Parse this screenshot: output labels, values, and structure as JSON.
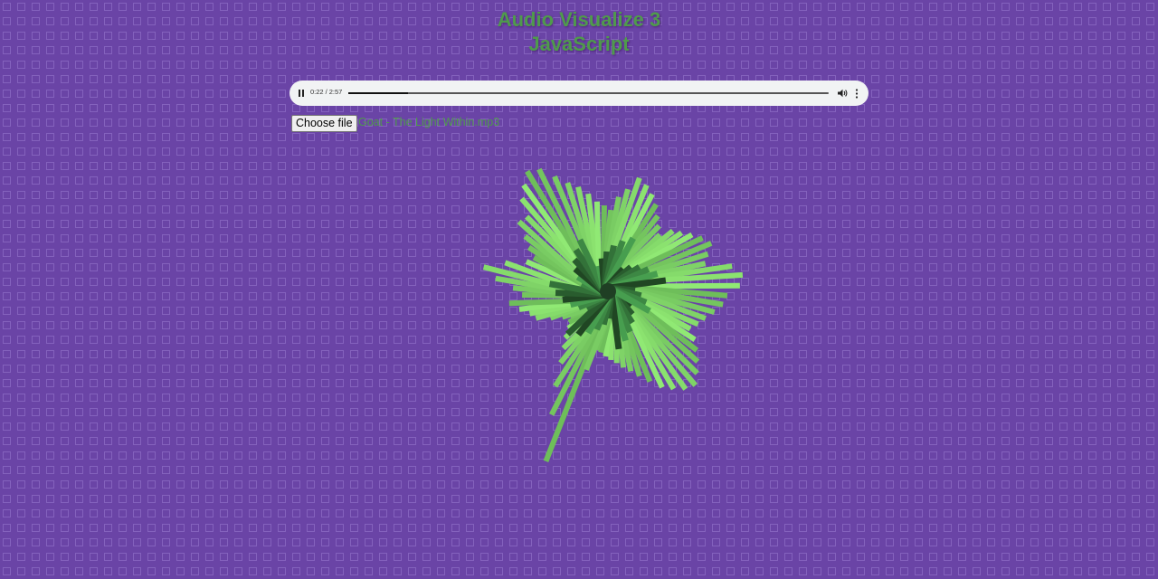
{
  "page": {
    "title_line1": "Audio Visualize 3",
    "title_line2": "JavaScript",
    "background": "#6a44a6",
    "accent": "#4f9a4c"
  },
  "player": {
    "current_time": "0:22",
    "duration": "2:57",
    "separator": "/",
    "progress_fraction": 0.124,
    "play_icon": "pause-icon",
    "volume_icon": "volume-icon",
    "menu_icon": "more-vertical-icon"
  },
  "file_input": {
    "button_label": "Choose file",
    "file_name": "Goat - The Light Within.mp3"
  },
  "visualizer": {
    "bar_color_light": "#7fdc6a",
    "bar_color_dark": "#2f6b38"
  }
}
